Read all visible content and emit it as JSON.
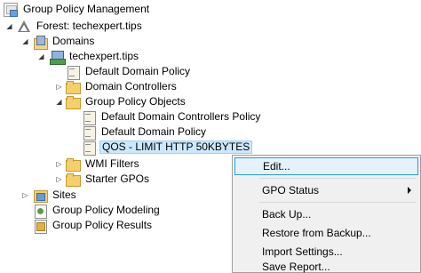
{
  "tree": {
    "root": "Group Policy Management",
    "forest": "Forest: techexpert.tips",
    "domains": "Domains",
    "domain": "techexpert.tips",
    "default_domain_policy": "Default Domain Policy",
    "domain_controllers": "Domain Controllers",
    "gpo_folder": "Group Policy Objects",
    "gpo_items": [
      "Default Domain Controllers Policy",
      "Default Domain Policy",
      "QOS - LIMIT HTTP 50KBYTES"
    ],
    "wmi_filters": "WMI Filters",
    "starter_gpos": "Starter GPOs",
    "sites": "Sites",
    "modeling": "Group Policy Modeling",
    "results": "Group Policy Results"
  },
  "context_menu": {
    "items": [
      "Edit...",
      "GPO Status",
      "Back Up...",
      "Restore from Backup...",
      "Import Settings...",
      "Save Report..."
    ],
    "highlighted": "Edit..."
  },
  "colors": {
    "selection_fill": "#cce8ff",
    "selection_border": "#99d1ff",
    "menu_highlight": "#e5f1fb",
    "menu_highlight_border": "#26a0da",
    "menu_background": "#f0f0f0"
  },
  "icons": {
    "root": "gpm-console-icon",
    "forest": "forest-icon",
    "domains": "domains-icon",
    "domain": "domain-icon",
    "gpo": "gpo-icon",
    "folder": "folder-icon",
    "sites": "sites-icon",
    "modeling": "modeling-icon",
    "results": "results-icon"
  }
}
